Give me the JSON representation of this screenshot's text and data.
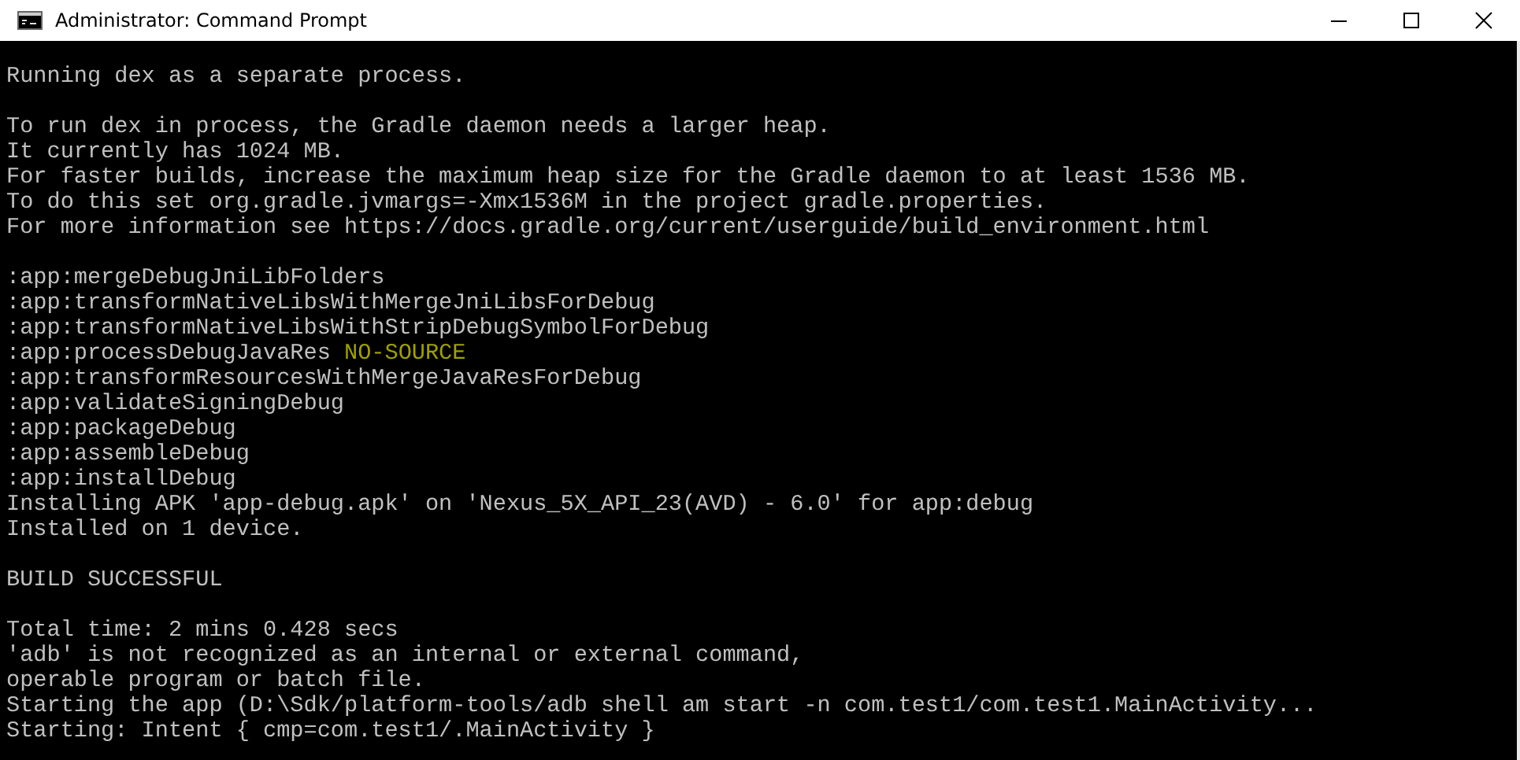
{
  "window": {
    "title": "Administrator: Command Prompt"
  },
  "console": {
    "lines": [
      {
        "kind": "text",
        "text": "Running dex as a separate process."
      },
      {
        "kind": "blank"
      },
      {
        "kind": "text",
        "text": "To run dex in process, the Gradle daemon needs a larger heap."
      },
      {
        "kind": "text",
        "text": "It currently has 1024 MB."
      },
      {
        "kind": "text",
        "text": "For faster builds, increase the maximum heap size for the Gradle daemon to at least 1536 MB."
      },
      {
        "kind": "text",
        "text": "To do this set org.gradle.jvmargs=-Xmx1536M in the project gradle.properties."
      },
      {
        "kind": "text",
        "text": "For more information see https://docs.gradle.org/current/userguide/build_environment.html"
      },
      {
        "kind": "blank"
      },
      {
        "kind": "text",
        "text": ":app:mergeDebugJniLibFolders"
      },
      {
        "kind": "text",
        "text": ":app:transformNativeLibsWithMergeJniLibsForDebug"
      },
      {
        "kind": "text",
        "text": ":app:transformNativeLibsWithStripDebugSymbolForDebug"
      },
      {
        "kind": "text",
        "text": ":app:processDebugJavaRes",
        "tag": "NO-SOURCE"
      },
      {
        "kind": "text",
        "text": ":app:transformResourcesWithMergeJavaResForDebug"
      },
      {
        "kind": "text",
        "text": ":app:validateSigningDebug"
      },
      {
        "kind": "text",
        "text": ":app:packageDebug"
      },
      {
        "kind": "text",
        "text": ":app:assembleDebug"
      },
      {
        "kind": "text",
        "text": ":app:installDebug"
      },
      {
        "kind": "text",
        "text": "Installing APK 'app-debug.apk' on 'Nexus_5X_API_23(AVD) - 6.0' for app:debug"
      },
      {
        "kind": "text",
        "text": "Installed on 1 device."
      },
      {
        "kind": "blank"
      },
      {
        "kind": "text",
        "text": "BUILD SUCCESSFUL"
      },
      {
        "kind": "blank"
      },
      {
        "kind": "text",
        "text": "Total time: 2 mins 0.428 secs"
      },
      {
        "kind": "text",
        "text": "'adb' is not recognized as an internal or external command,"
      },
      {
        "kind": "text",
        "text": "operable program or batch file."
      },
      {
        "kind": "text",
        "text": "Starting the app (D:\\Sdk/platform-tools/adb shell am start -n com.test1/com.test1.MainActivity..."
      },
      {
        "kind": "text",
        "text": "Starting: Intent { cmp=com.test1/.MainActivity }"
      }
    ]
  }
}
